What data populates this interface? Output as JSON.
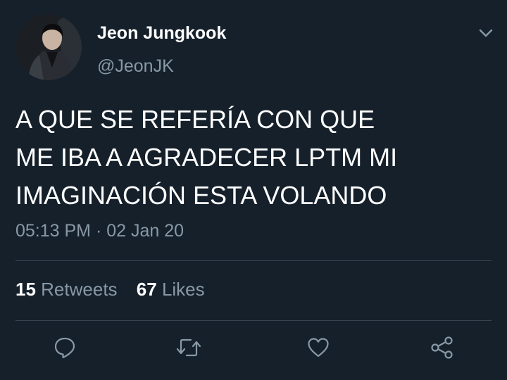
{
  "tweet": {
    "author": {
      "display_name": "Jeon Jungkook",
      "handle": "@JeonJK",
      "avatar": "profile-photo"
    },
    "text_lines": [
      "A QUE SE REFERÍA CON QUE",
      "ME IBA A AGRADECER LPTM MI",
      "IMAGINACIÓN ESTA VOLANDO"
    ],
    "timestamp": "05:13 PM · 02 Jan 20",
    "stats": {
      "retweets_count": "15",
      "retweets_label": "Retweets",
      "likes_count": "67",
      "likes_label": "Likes"
    },
    "actions": [
      "reply-icon",
      "retweet-icon",
      "like-icon",
      "share-icon"
    ],
    "menu_icon": "chevron-down-icon"
  },
  "colors": {
    "background": "#15202b",
    "primary_text": "#ffffff",
    "secondary_text": "#8899a6",
    "divider": "#38444d"
  }
}
